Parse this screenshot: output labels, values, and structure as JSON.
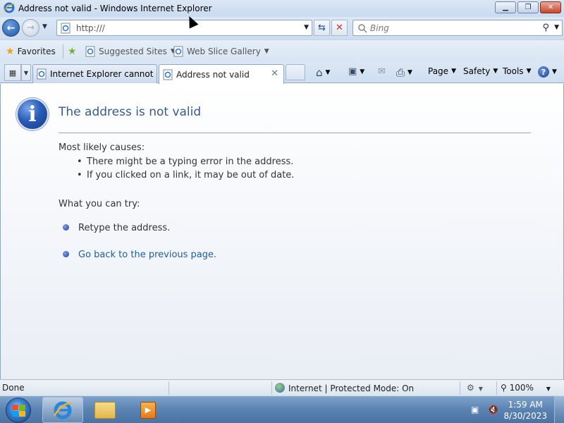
{
  "window": {
    "title": "Address not valid - Windows Internet Explorer",
    "minimize_icon": "minimize-icon",
    "maximize_icon": "maximize-icon",
    "close_icon": "close-icon"
  },
  "nav": {
    "address_value": "http:///",
    "search_placeholder": "Bing"
  },
  "favorites_bar": {
    "favorites_label": "Favorites",
    "suggested_sites": "Suggested Sites",
    "web_slice_gallery": "Web Slice Gallery"
  },
  "tabs": [
    {
      "label": "Internet Explorer cannot di...",
      "active": false
    },
    {
      "label": "Address not valid",
      "active": true
    }
  ],
  "commandbar": {
    "page": "Page",
    "safety": "Safety",
    "tools": "Tools"
  },
  "error_page": {
    "heading": "The address is not valid",
    "causes_title": "Most likely causes:",
    "causes": [
      "There might be a typing error in the address.",
      "If you clicked on a link, it may be out of date."
    ],
    "try_title": "What you can try:",
    "actions": [
      {
        "label": "Retype the address.",
        "link": false
      },
      {
        "label": "Go back to the previous page.",
        "link": true
      }
    ]
  },
  "statusbar": {
    "status": "Done",
    "zone": "Internet | Protected Mode: On",
    "zoom": "100%"
  },
  "taskbar": {
    "time": "1:59 AM",
    "date": "8/30/2023"
  },
  "colors": {
    "heading": "#3a5a8c",
    "link": "#1f5d9e",
    "taskbar": "#5a83b3"
  }
}
